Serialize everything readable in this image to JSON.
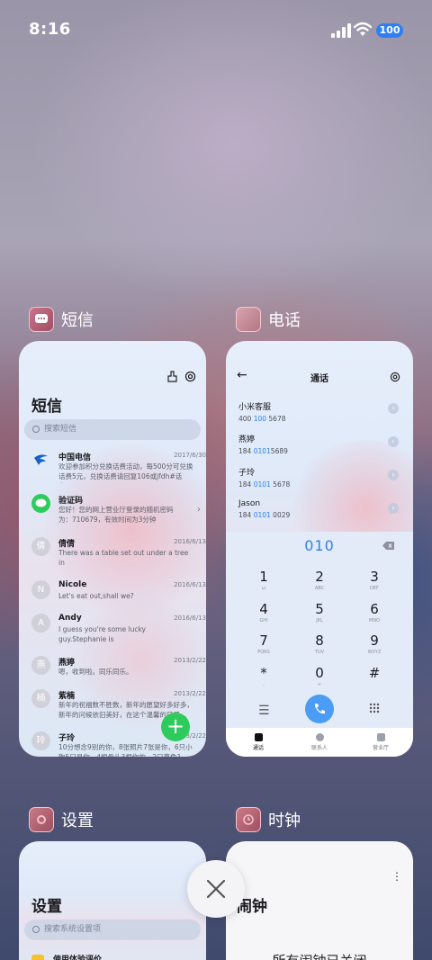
{
  "status": {
    "time": "8:16",
    "battery": "100"
  },
  "apps": [
    {
      "name": "短信"
    },
    {
      "name": "电话"
    },
    {
      "name": "设置"
    },
    {
      "name": "时钟"
    }
  ],
  "sms": {
    "title": "短信",
    "search_placeholder": "搜索短信",
    "messages": [
      {
        "avatar": "",
        "name": "中国电信",
        "date": "2017/6/30",
        "text": "欢迎参加积分兑换话费活动，每500分可兑换\n话费5元，兑换话费请回复106或jfdh#话费..."
      },
      {
        "avatar": "",
        "name": "验证码",
        "date": "",
        "text": "您好！您的网上营业厅登录的随机密码\n为：710679，有效时间为3分钟"
      },
      {
        "avatar": "倩",
        "name": "倩倩",
        "date": "2016/6/13",
        "text": "There was a table set out under a tree in\nfront of the house,and the March Hare an..."
      },
      {
        "avatar": "N",
        "name": "Nicole",
        "date": "2016/6/13",
        "text": "Let's eat out,shall we?"
      },
      {
        "avatar": "A",
        "name": "Andy",
        "date": "2016/6/13",
        "text": "I guess you're some lucky guy.Stephanie is\na nice girl."
      },
      {
        "avatar": "燕",
        "name": "燕婷",
        "date": "2013/2/22",
        "text": "嗯，收到啦。同乐同乐。"
      },
      {
        "avatar": "楠",
        "name": "紫楠",
        "date": "2013/2/22",
        "text": "新年的祝福数不胜数，新年的愿望好多好多，\n新年的问候依旧美好，在这个温馨的日子..."
      },
      {
        "avatar": "玲",
        "name": "子玲",
        "date": "2013/2/22",
        "text": "10分想念9别的你，8张照片7张是你，6只小\n狗5只是你，4根骨头3根你的，2只草兔1只..."
      }
    ]
  },
  "phone": {
    "title": "通话",
    "contacts": [
      {
        "name": "小米客服",
        "num_pre": "400 ",
        "num_hl": "100",
        "num_post": " 5678"
      },
      {
        "name": "燕婷",
        "num_pre": "184 ",
        "num_hl": "0101",
        "num_post": "5689"
      },
      {
        "name": "子玲",
        "num_pre": "184 ",
        "num_hl": "0101",
        "num_post": " 5678"
      },
      {
        "name": "Jason",
        "num_pre": "184 ",
        "num_hl": "0101",
        "num_post": " 0029"
      }
    ],
    "dialed": "010",
    "keys": [
      {
        "d": "1",
        "l": "ω"
      },
      {
        "d": "2",
        "l": "ABC"
      },
      {
        "d": "3",
        "l": "DEF"
      },
      {
        "d": "4",
        "l": "GHI"
      },
      {
        "d": "5",
        "l": "JKL"
      },
      {
        "d": "6",
        "l": "MNO"
      },
      {
        "d": "7",
        "l": "PQRS"
      },
      {
        "d": "8",
        "l": "TUV"
      },
      {
        "d": "9",
        "l": "WXYZ"
      },
      {
        "d": "*",
        "l": ","
      },
      {
        "d": "0",
        "l": "+"
      },
      {
        "d": "#",
        "l": ""
      }
    ],
    "tabs": [
      "通话",
      "联系人",
      "营业厅"
    ]
  },
  "settings": {
    "title": "设置",
    "search_placeholder": "搜索系统设置项",
    "first_item": "使用体验评价"
  },
  "clock": {
    "title": "闹钟",
    "empty_text": "所有闹钟已关闭"
  },
  "colors": {
    "accent": "#2f7ff0",
    "fab": "#2dcb5b",
    "call": "#4a9cf5"
  }
}
